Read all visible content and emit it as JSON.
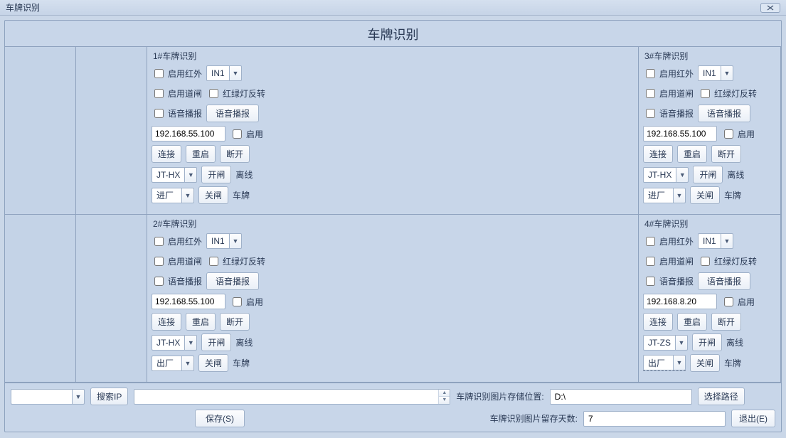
{
  "window": {
    "title": "车牌识别",
    "page_title": "车牌识别"
  },
  "labels": {
    "enable_ir": "启用红外",
    "enable_gate": "启用道闸",
    "traffic_invert": "红绿灯反转",
    "voice_broadcast": "语音播报",
    "voice_btn": "语音播报",
    "enable": "启用",
    "connect": "连接",
    "reboot": "重启",
    "disconnect": "断开",
    "open_gate": "开闸",
    "close_gate": "关闸",
    "offline": "离线",
    "plate": "车牌",
    "search_ip": "搜索IP",
    "save": "保存(S)",
    "img_path_label": "车牌识别图片存储位置:",
    "choose_path": "选择路径",
    "img_keep_days_label": "车牌识别图片留存天数:",
    "exit": "退出(E)"
  },
  "panels": [
    {
      "title": "1#车牌识别",
      "in_ch": "IN1",
      "ip": "192.168.55.100",
      "dev": "JT-HX",
      "dir": "进厂"
    },
    {
      "title": "2#车牌识别",
      "in_ch": "IN1",
      "ip": "192.168.55.100",
      "dev": "JT-HX",
      "dir": "出厂"
    },
    {
      "title": "3#车牌识别",
      "in_ch": "IN1",
      "ip": "192.168.55.100",
      "dev": "JT-HX",
      "dir": "进厂"
    },
    {
      "title": "4#车牌识别",
      "in_ch": "IN1",
      "ip": "192.168.8.20",
      "dev": "JT-ZS",
      "dir": "出厂"
    }
  ],
  "bottom": {
    "search_value": "",
    "img_path": "D:\\",
    "keep_days": "7"
  }
}
